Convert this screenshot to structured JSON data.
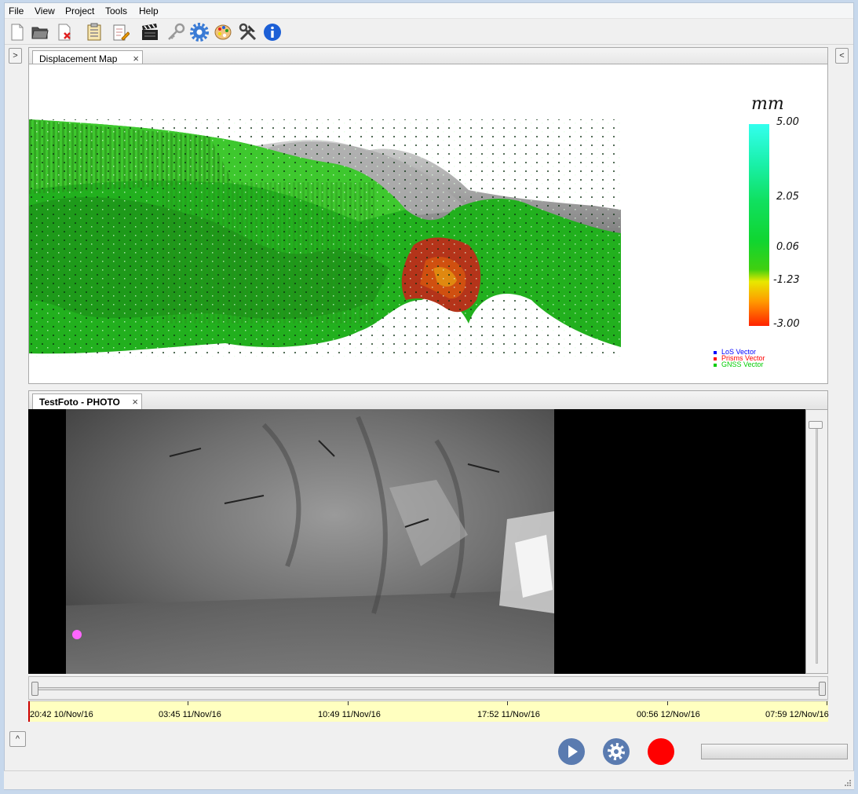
{
  "menu": [
    "File",
    "View",
    "Project",
    "Tools",
    "Help"
  ],
  "toolbar": {
    "icons": [
      "new-file-icon",
      "open-folder-icon",
      "close-file-icon",
      "report-icon",
      "edit-report-icon",
      "clapperboard-icon",
      "key-icon",
      "gear-icon",
      "palette-icon",
      "tools-icon",
      "info-icon"
    ]
  },
  "side": {
    "left_toggle": ">",
    "right_toggle": "<",
    "collapse": "^"
  },
  "map_panel": {
    "tab_label": "Displacement Map",
    "close": "×",
    "legend": {
      "unit": "mm",
      "labels": [
        "5.00",
        "2.05",
        "0.06",
        "-1.23",
        "-3.00"
      ],
      "vectors": [
        {
          "label": "LoS Vector",
          "color": "#0000ff"
        },
        {
          "label": "Prisms Vector",
          "color": "#ff0000"
        },
        {
          "label": "GNSS Vector",
          "color": "#00cc00"
        }
      ]
    }
  },
  "photo_panel": {
    "tab_label": "TestFoto - PHOTO",
    "close": "×"
  },
  "timeline": {
    "labels": [
      "20:42 10/Nov/16",
      "03:45 11/Nov/16",
      "10:49 11/Nov/16",
      "17:52 11/Nov/16",
      "00:56 12/Nov/16",
      "07:59 12/Nov/16"
    ]
  },
  "controls": [
    "play-button",
    "settings-button",
    "record-button"
  ],
  "colors": {
    "play": "#5a7bb0",
    "record": "#ff0000"
  }
}
